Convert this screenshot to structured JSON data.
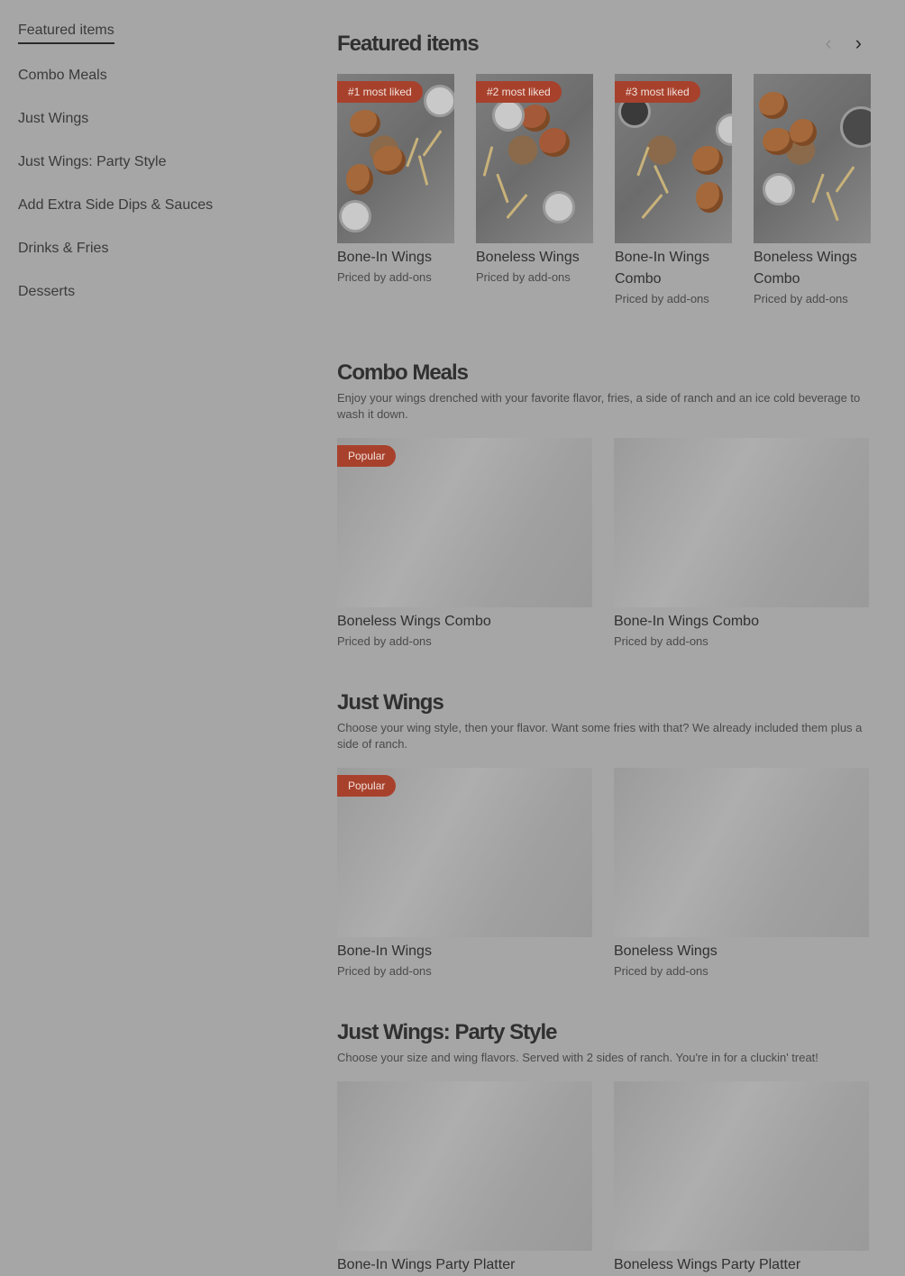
{
  "sidebar": {
    "items": [
      {
        "label": "Featured items"
      },
      {
        "label": "Combo Meals"
      },
      {
        "label": "Just Wings"
      },
      {
        "label": "Just Wings: Party Style"
      },
      {
        "label": "Add Extra Side Dips & Sauces"
      },
      {
        "label": "Drinks & Fries"
      },
      {
        "label": "Desserts"
      }
    ]
  },
  "featured": {
    "title": "Featured items",
    "prev_icon": "chevron-left-icon",
    "next_icon": "chevron-right-icon",
    "items": [
      {
        "badge": "#1 most liked",
        "name": "Bone-In Wings",
        "price": "Priced by add-ons"
      },
      {
        "badge": "#2 most liked",
        "name": "Boneless Wings",
        "price": "Priced by add-ons"
      },
      {
        "badge": "#3 most liked",
        "name": "Bone-In Wings Combo",
        "price": "Priced by add-ons"
      },
      {
        "badge": "",
        "name": "Boneless Wings Combo",
        "price": "Priced by add-ons"
      }
    ]
  },
  "combo": {
    "title": "Combo Meals",
    "description": "Enjoy your wings drenched with your favorite flavor, fries, a side of ranch and an ice cold beverage to wash it down.",
    "items": [
      {
        "badge": "Popular",
        "name": "Boneless Wings Combo",
        "price": "Priced by add-ons"
      },
      {
        "badge": "",
        "name": "Bone-In Wings Combo",
        "price": "Priced by add-ons"
      }
    ]
  },
  "just_wings": {
    "title": "Just Wings",
    "description": "Choose your wing style, then your flavor. Want some fries with that? We already included them plus a side of ranch.",
    "items": [
      {
        "badge": "Popular",
        "name": "Bone-In Wings",
        "price": "Priced by add-ons"
      },
      {
        "badge": "",
        "name": "Boneless Wings",
        "price": "Priced by add-ons"
      }
    ]
  },
  "party": {
    "title": "Just Wings: Party Style",
    "description": "Choose your size and wing flavors. Served with 2 sides of ranch. You're in for a cluckin' treat!",
    "items": [
      {
        "name": "Bone-In Wings Party Platter"
      },
      {
        "name": "Boneless Wings Party Platter"
      }
    ]
  },
  "colors": {
    "overlay_bg": "#a6a6a6",
    "badge_bg": "#a8412c"
  }
}
